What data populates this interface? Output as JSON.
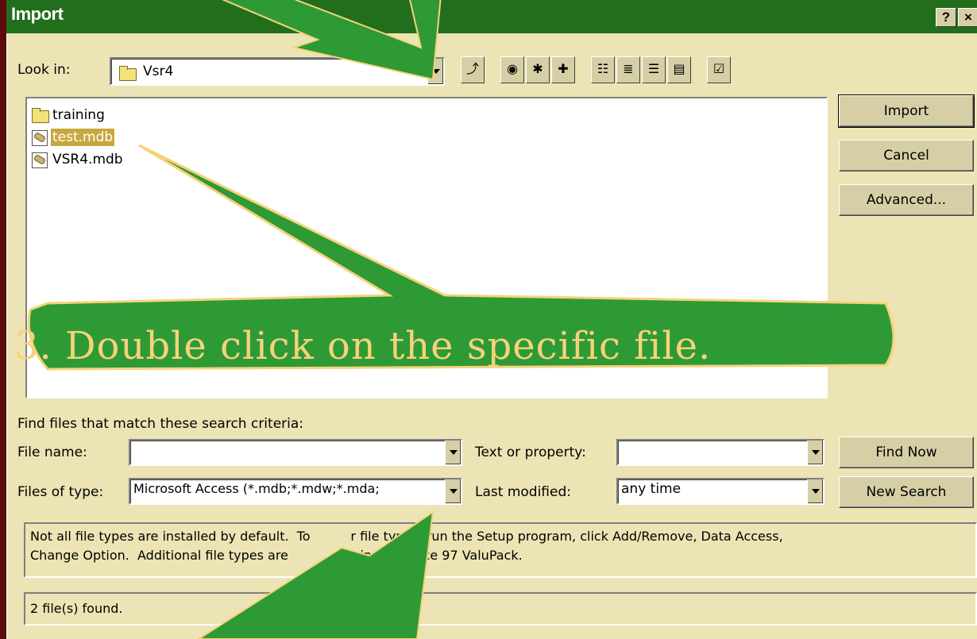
{
  "window": {
    "title": "Import",
    "help_label": "?",
    "close_label": "×"
  },
  "lookin": {
    "label": "Look in:",
    "value": "Vsr4"
  },
  "toolbar": {
    "icons": [
      "up-one-level-icon",
      "search-web-icon",
      "look-in-favorites-icon",
      "add-to-favorites-icon",
      "list-view-icon",
      "details-view-icon",
      "properties-view-icon",
      "preview-view-icon",
      "commands-settings-icon"
    ]
  },
  "files": [
    {
      "name": "training",
      "type": "folder",
      "selected": false
    },
    {
      "name": "test.mdb",
      "type": "mdb",
      "selected": true
    },
    {
      "name": "VSR4.mdb",
      "type": "mdb",
      "selected": false
    }
  ],
  "buttons": {
    "import": "Import",
    "cancel": "Cancel",
    "advanced": "Advanced...",
    "find_now": "Find Now",
    "new_search": "New Search"
  },
  "search": {
    "heading": "Find files that match these search criteria:",
    "filename_label": "File name:",
    "filename_value": "",
    "filetype_label": "Files of type:",
    "filetype_value": "Microsoft Access (*.mdb;*.mdw;*.mda;",
    "text_label": "Text or property:",
    "text_value": "",
    "modified_label": "Last modified:",
    "modified_value": "any time"
  },
  "info": {
    "line1": "Not all file types are installed by default.  To          r file types, run the Setup program, click Add/Remove, Data Access,",
    "line2": "Change Option.  Additional file types are              le in the Office 97 ValuPack."
  },
  "status": "2 file(s) found.",
  "annotation": {
    "text": "3.  Double click on the specific file."
  },
  "colors": {
    "dialog_bg": "#ece4b4",
    "titlebar": "#226e1c",
    "arrow_fill": "#2e9a36",
    "arrow_stroke": "#f6d27a",
    "callout_text": "#f6d27a",
    "selection": "#c7a83e"
  }
}
